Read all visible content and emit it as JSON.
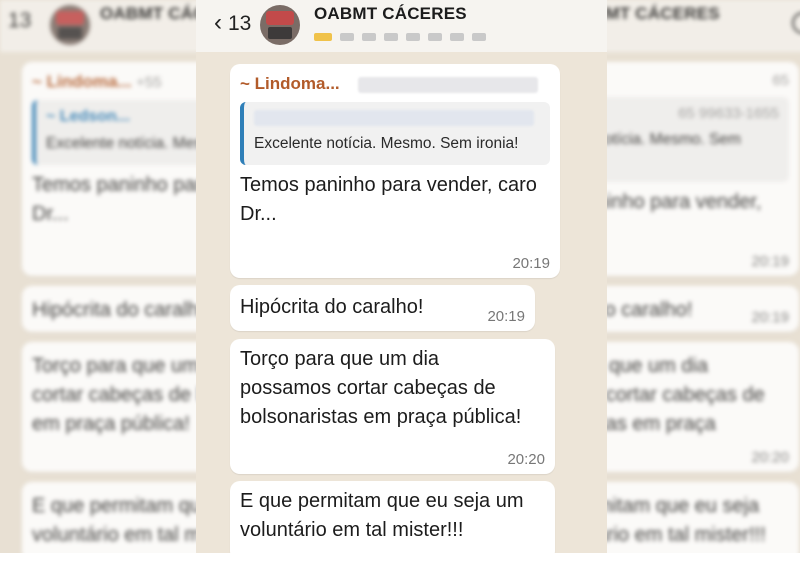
{
  "header": {
    "unread_count": "13",
    "group_name": "OABMT CÁCERES"
  },
  "messages": [
    {
      "sender": "~ Lindoma...",
      "quote_text": "Excelente notícia. Mesmo. Sem ironia!",
      "text": "Temos paninho para vender, caro Dr...",
      "time": "20:19"
    },
    {
      "text": "Hipócrita do caralho!",
      "time": "20:19"
    },
    {
      "text": "Torço para que um dia possamos cortar cabeças de bolsonaristas em praça pública!",
      "time": "20:20"
    },
    {
      "text": "E que permitam que eu seja um voluntário em tal mister!!!"
    }
  ],
  "side_left": {
    "unread_count": "13",
    "group_name": "OABMT CÁCERES",
    "sender": "~ Lindoma...",
    "phone": "+55",
    "quote_name": "~ Ledson...",
    "quote_text": "Excelente notícia. Mesmo. Sem ironia!",
    "text": "Temos paninho para vender, caro Dr...",
    "text2": "Hipócrita do caralho!",
    "text3": "Torço para que um dia possamos cortar cabeças de bolsonaristas em praça pública!",
    "text4": "E que permitam que eu seja um voluntário em tal mister!!!"
  },
  "side_right": {
    "group_name": "OABMT CÁCERES",
    "phone": "65",
    "quote_phone": "65 99633-1655",
    "quote_text": "Excelente notícia. Mesmo. Sem ironia!",
    "text": "Temos paninho para vender, caro Dr...",
    "time1": "20:19",
    "text2": "Hipócrita do caralho!",
    "time2": "20:19",
    "text3": "Torço para que um dia possamos cortar cabeças de bolsonaristas em praça pública!",
    "time3": "20:20",
    "text4": "E que permitam que eu seja um voluntário em tal mister!!!"
  },
  "colors": {
    "chat_background": "#ede5d8",
    "sender_name": "#b25b2a",
    "quote_bar": "#2f7fb8",
    "bubble": "#ffffff"
  }
}
